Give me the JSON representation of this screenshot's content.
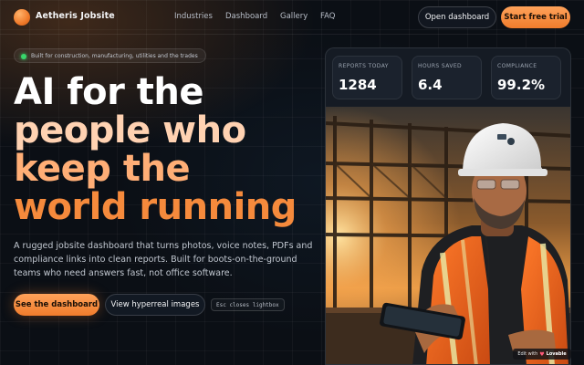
{
  "brand": {
    "name": "Aetheris Jobsite"
  },
  "nav": {
    "links": [
      "Industries",
      "Dashboard",
      "Gallery",
      "FAQ"
    ],
    "open_dashboard": "Open dashboard",
    "start_trial": "Start free trial"
  },
  "hero": {
    "badge": "Built for construction, manufacturing, utilities and the trades",
    "headline": [
      "AI for the",
      "people who",
      "keep the",
      "world running"
    ],
    "subtitle": "A rugged jobsite dashboard that turns photos, voice notes, PDFs and compliance links into clean reports. Built for boots-on-the-ground teams who need answers fast, not office software.",
    "cta_primary": "See the dashboard",
    "cta_secondary": "View hyperreal images",
    "kbd_hint": "Esc closes lightbox"
  },
  "stats": [
    {
      "label": "REPORTS TODAY",
      "value": "1284"
    },
    {
      "label": "HOURS SAVED",
      "value": "6.4"
    },
    {
      "label": "COMPLIANCE",
      "value": "99.2%"
    }
  ],
  "badge_lovable": {
    "prefix": "Edit with",
    "name": "Lovable"
  },
  "icons": {
    "logo": "orange-orb-logo",
    "status_dot": "green-dot-icon",
    "heart": "heart-icon"
  },
  "colors": {
    "accent": "#f58a3c",
    "accent_light": "#ffa25a",
    "background": "#0b0f15",
    "status_green": "#38d66b"
  }
}
